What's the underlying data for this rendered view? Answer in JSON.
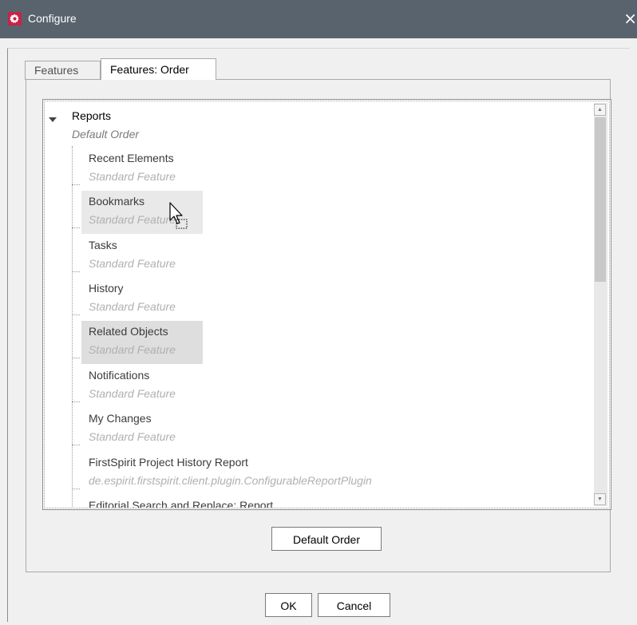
{
  "window": {
    "title": "Configure",
    "close_glyph": "×",
    "app_icon": "gear-icon",
    "app_icon_color": "#c7234a",
    "titlebar_color": "#59636d"
  },
  "tabs": [
    {
      "label": "Features",
      "active": false
    },
    {
      "label": "Features: Order",
      "active": true
    }
  ],
  "tree": {
    "root": {
      "label": "Reports",
      "sublabel": "Default Order"
    },
    "items": [
      {
        "label": "Recent Elements",
        "sublabel": "Standard Feature"
      },
      {
        "label": "Bookmarks",
        "sublabel": "Standard Feature"
      },
      {
        "label": "Tasks",
        "sublabel": "Standard Feature"
      },
      {
        "label": "History",
        "sublabel": "Standard Feature"
      },
      {
        "label": "Related Objects",
        "sublabel": "Standard Feature"
      },
      {
        "label": "Notifications",
        "sublabel": "Standard Feature"
      },
      {
        "label": "My Changes",
        "sublabel": "Standard Feature"
      },
      {
        "label": "FirstSpirit Project History Report",
        "sublabel": "de.espirit.firstspirit.client.plugin.ConfigurableReportPlugin"
      },
      {
        "label": "Editorial Search and Replace: Report",
        "sublabel": ""
      }
    ]
  },
  "buttons": {
    "default_order": "Default Order",
    "ok": "OK",
    "cancel": "Cancel"
  }
}
